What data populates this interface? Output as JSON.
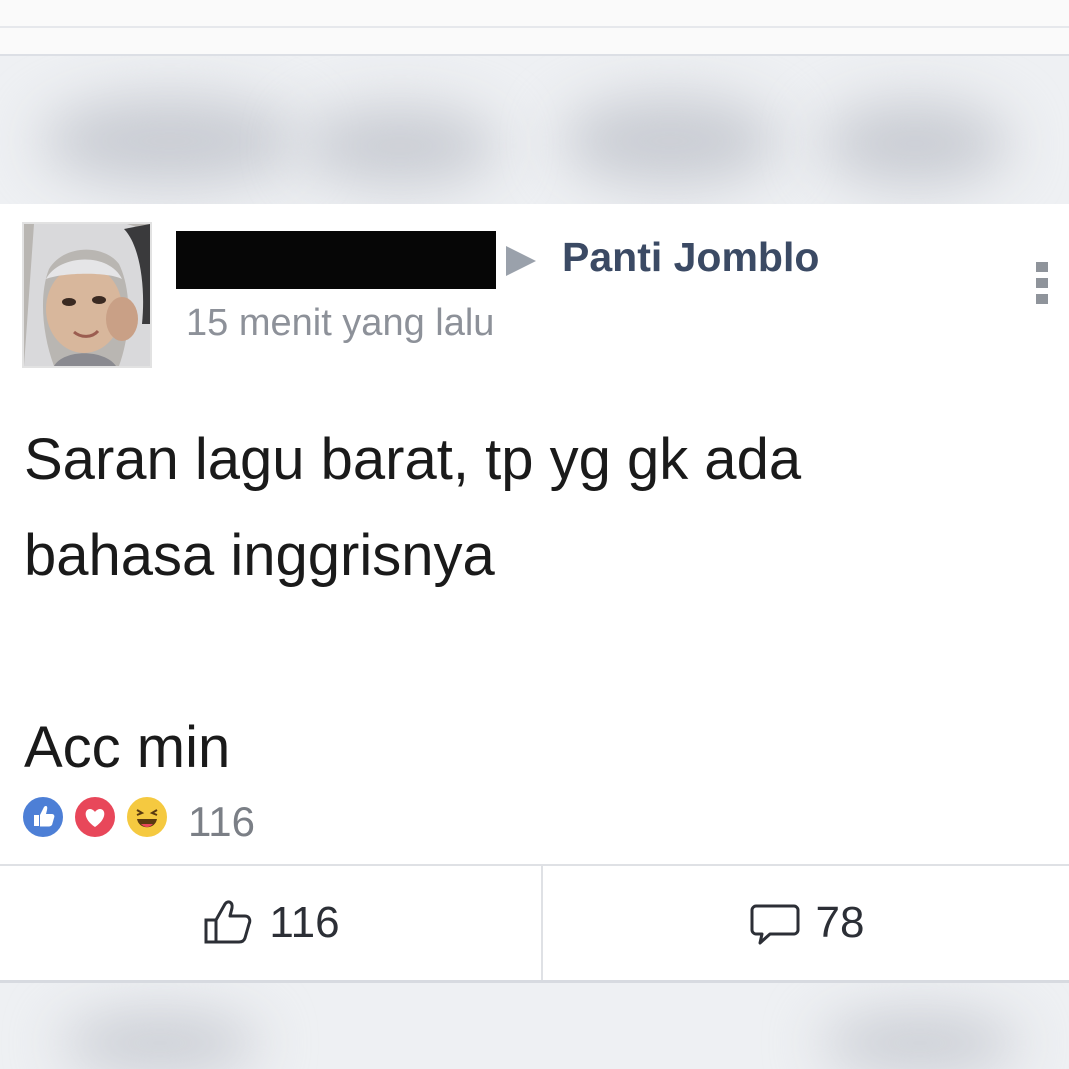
{
  "post": {
    "group_name": "Panti Jomblo",
    "timestamp": "15 menit yang lalu",
    "body": "Saran lagu barat, tp yg gk ada\nbahasa inggrisnya\n\nAcc min"
  },
  "reactions": {
    "types": [
      "like",
      "love",
      "haha"
    ],
    "count": "116"
  },
  "actions": {
    "like_count": "116",
    "comment_count": "78"
  },
  "icons": {
    "like": "thumbs-up-icon",
    "comment": "speech-bubble-icon",
    "more": "more-vertical-icon"
  },
  "colors": {
    "group_name": "#3b4a64",
    "like_reaction": "#4d7fd6",
    "love_reaction": "#e8475a",
    "haha_reaction": "#f5c940"
  }
}
